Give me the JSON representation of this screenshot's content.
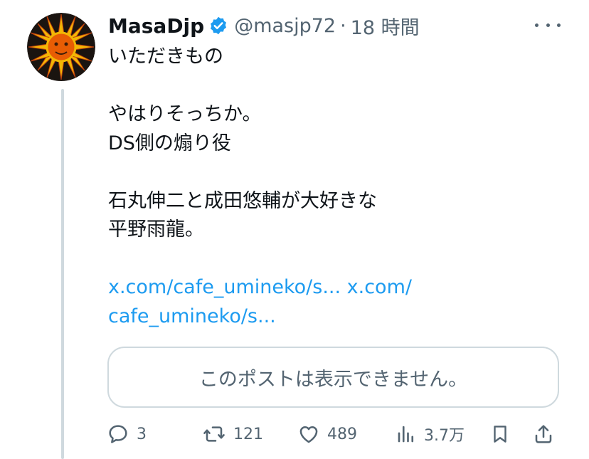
{
  "post": {
    "display_name": "MasaDjp",
    "handle": "@masjp72",
    "separator": "·",
    "time": "18 時間",
    "text_lines": [
      "いただきもの",
      "",
      "やはりそっちか。",
      "DS側の煽り役",
      "",
      "石丸伸二と成田悠輔が大好きな",
      "平野雨龍。",
      ""
    ],
    "link_line_1": "x.com/cafe_umineko/s... x.com/",
    "link_line_2": "cafe_umineko/s...",
    "quoted_unavailable": "このポストは表示できません。"
  },
  "actions": {
    "replies": "3",
    "reposts": "121",
    "likes": "489",
    "views": "3.7万"
  },
  "icons": {
    "verified": "verified-badge-icon",
    "more": "more-options-icon",
    "reply": "reply-icon",
    "repost": "repost-icon",
    "like": "heart-icon",
    "views": "analytics-icon",
    "bookmark": "bookmark-icon",
    "share": "share-icon"
  },
  "colors": {
    "text": "#0f1419",
    "secondary": "#536471",
    "link": "#1d9bf0",
    "border": "#cfd9de",
    "verified": "#1d9bf0"
  }
}
